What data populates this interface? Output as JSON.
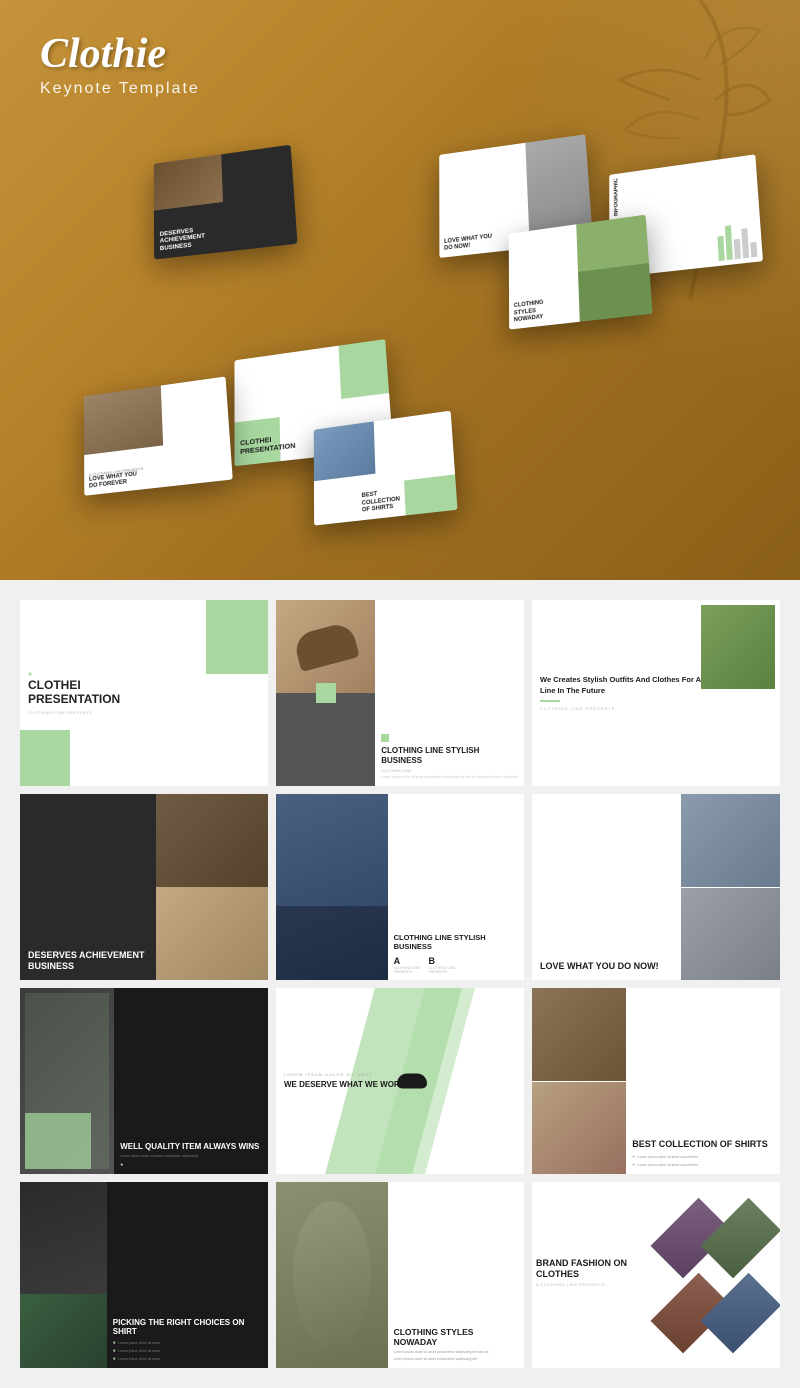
{
  "brand": {
    "logo": "Clothie",
    "subtitle": "Keynote Template"
  },
  "slides": [
    {
      "id": 1,
      "title": "CLOTHEI\nPRESENTATION",
      "label": "CLOTHING LINE PRESENTS",
      "type": "white"
    },
    {
      "id": 2,
      "title": "CLOTHING LINE STYLISH BUSINESS",
      "label": "CLOTHING LINE",
      "type": "image"
    },
    {
      "id": 3,
      "title": "We Creates Stylish Outfits And Clothes For A Better Clothing Line In The Future",
      "label": "CLOTHING LINE PRESENTS",
      "type": "text"
    },
    {
      "id": 4,
      "title": "DESERVES\nACHIEVEMENT\nBUSINESS",
      "label": "",
      "type": "dark"
    },
    {
      "id": 5,
      "title": "CLOTHING\nLINE STYLISH\nBUSINESS",
      "label": "A  B",
      "type": "white"
    },
    {
      "id": 6,
      "title": "LOVE WHAT YOU\nDO NOW!",
      "label": "",
      "type": "image"
    },
    {
      "id": 7,
      "title": "WELL QUALITY ITEM\nALWAYS WINS",
      "label": "",
      "type": "dark"
    },
    {
      "id": 8,
      "title": "WE DESERVE WHAT\nWE WORKED",
      "label": "",
      "type": "white"
    },
    {
      "id": 9,
      "title": "BEST\nCOLLECTION\nOF SHIRTS",
      "label": "",
      "type": "image"
    },
    {
      "id": 10,
      "title": "PICKING THE\nRIGHT CHOICES\nON SHIRT",
      "label": "",
      "type": "dark"
    },
    {
      "id": 11,
      "title": "CLOTHING\nSTYLES\nNOWADAY",
      "label": "",
      "type": "image"
    },
    {
      "id": 12,
      "title": "BRAND\nFASHION ON\nCLOTHES",
      "label": "A  CLOTHING LINE PRESENTS",
      "type": "diamond"
    }
  ],
  "mockup_cards": [
    {
      "label": "CLOTHEI PRESENTATION"
    },
    {
      "label": "LOVE WHAT YOU DO FOREVER"
    },
    {
      "label": "BEST COLLECTION OF SHIRTS"
    },
    {
      "label": "LOVE WHAT YOU DO NOW!"
    },
    {
      "label": "INFOGRAPHIC"
    },
    {
      "label": "DESERVES ACHIEVEMENT BUSINESS"
    },
    {
      "label": "CLOTHING STYLES NOWADAY"
    }
  ]
}
